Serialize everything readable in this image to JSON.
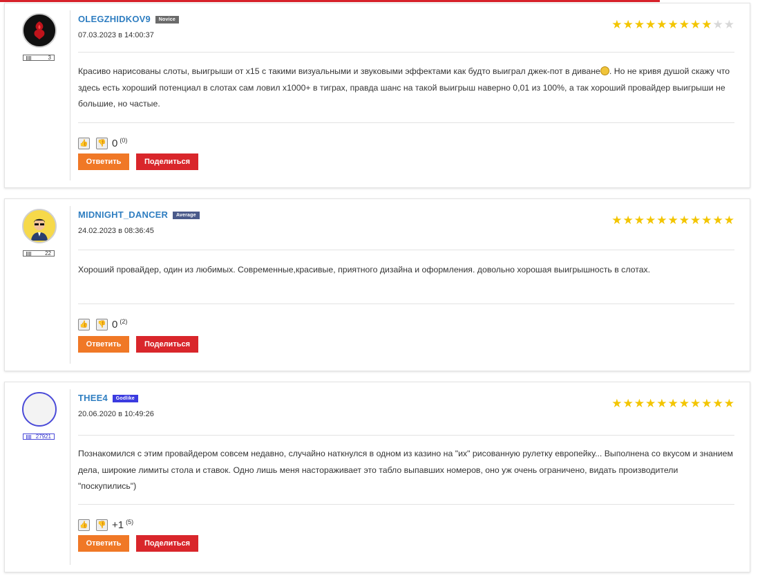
{
  "colors": {
    "accent_red": "#d7212a",
    "username": "#2f7ec1",
    "reply": "#f07826",
    "share": "#d9262b",
    "star": "#f3c500"
  },
  "reviews": [
    {
      "username": "OLEGZHIDKOV9",
      "badge": "Novice",
      "badge_color": "#6b6b6b",
      "date": "07.03.2023 в 14:00:37",
      "rank_number": "3",
      "rating": 9,
      "max_rating": 11,
      "text_part1": "Красиво нарисованы слоты, выигрыши от х15 с такими визуальными и звуковыми эффектами как будто выиграл джек-пот в диване",
      "text_part2": ". Но не кривя душой скажу что здесь есть хороший потенциал в слотах сам ловил х1000+ в тиграх, правда шанс на такой выигрыш наверно 0,01 из 100%, а так хороший провайдер выигрыши не большие, но частые.",
      "vote_score": "0",
      "vote_total": "(0)",
      "reply_label": "Ответить",
      "share_label": "Поделиться",
      "avatar_icon": "dragon-avatar-icon"
    },
    {
      "username": "MIDNIGHT_DANCER",
      "badge": "Average",
      "badge_color": "#4a5a8a",
      "date": "24.02.2023 в 08:36:45",
      "rank_number": "22",
      "rating": 11,
      "max_rating": 11,
      "text": "Хороший провайдер, один из любимых. Современные,красивые, приятного дизайна и оформления. довольно хорошая выигрышность в слотах.",
      "vote_score": "0",
      "vote_total": "(2)",
      "reply_label": "Ответить",
      "share_label": "Поделиться",
      "avatar_icon": "sunglasses-man-avatar-icon"
    },
    {
      "username": "THEE4",
      "badge": "Godlike",
      "badge_color": "#3b3be0",
      "date": "20.06.2020 в 10:49:26",
      "rank_number": "27921",
      "rating": 11,
      "max_rating": 11,
      "text": "Познакомился с этим провайдером совсем недавно, случайно наткнулся в одном из казино на \"их\" рисованную рулетку европейку... Выполнена со вкусом и знанием дела, широкие лимиты стола и ставок. Одно лишь меня настораживает это табло выпавших номеров, оно уж очень ограничено, видать производители \"поскупились\")",
      "vote_score": "+1",
      "vote_total": "(5)",
      "reply_label": "Ответить",
      "share_label": "Поделиться",
      "avatar_icon": "empty-avatar-icon"
    }
  ]
}
